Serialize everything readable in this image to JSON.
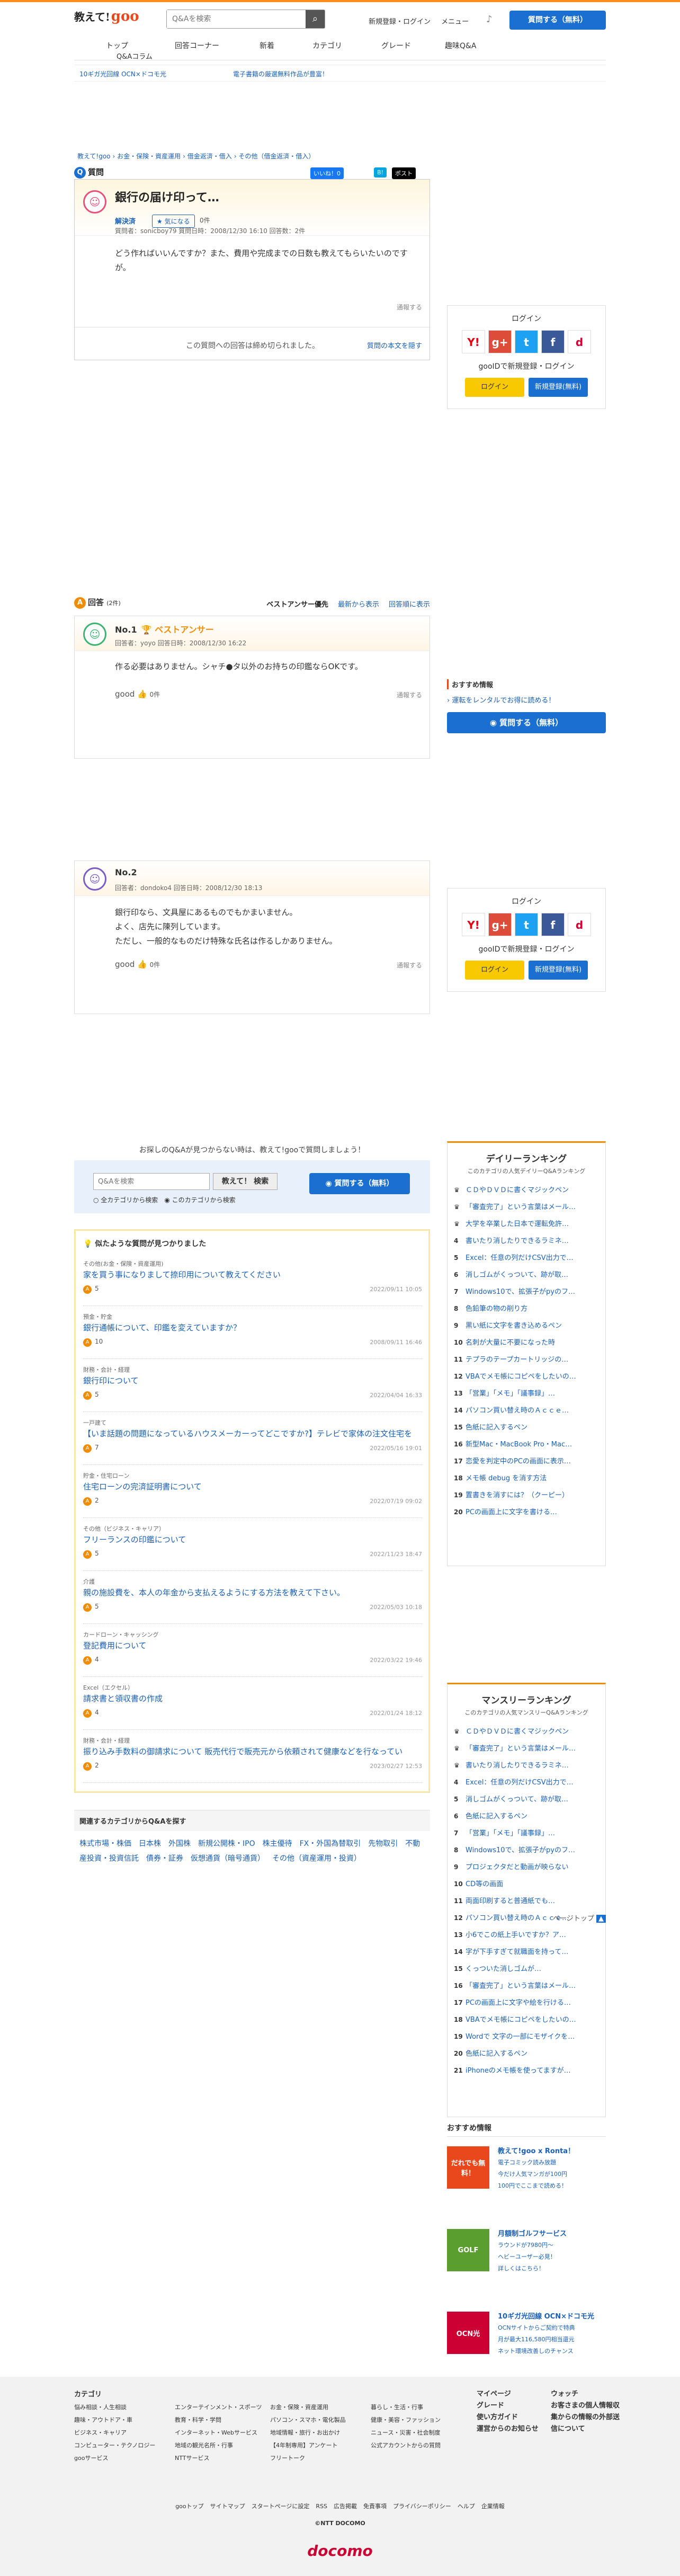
{
  "header": {
    "logo_small": "教えて!",
    "logo_main": "goo",
    "search_placeholder": "Q&Aを検索",
    "search_icon": "search-icon",
    "login_link": "新規登録・ログイン",
    "menu_link": "メニュー",
    "ask_button": "質問する（無料）"
  },
  "gnav": [
    "トップ",
    "回答コーナー",
    "新着",
    "カテゴリ",
    "グレード",
    "趣味Q&A"
  ],
  "gnav_sub": "Q&Aコラム",
  "ads": [
    "10ギガ光回線 OCN×ドコモ光",
    "電子書籍の厳選無料作品が豊富！"
  ],
  "breadcrumb": [
    "教えて!goo",
    "お金・保険・資産運用",
    "借金返済・借入",
    "その他（借金返済・借入）"
  ],
  "question": {
    "label": "質問",
    "share": [
      "いいね！0",
      "B!",
      "ポスト"
    ],
    "title": "銀行の届け印って…",
    "status": "解決済",
    "fav": "気になる",
    "fav_count": "0件",
    "meta": "質問者：sonicboy79  質問日時：2008/12/30 16:10  回答数：2件",
    "body": "どう作ればいいんですか？また、費用や完成までの日数も教えてもらいたいのですが。",
    "report": "通報する",
    "closed": "この質問への回答は締め切られました。",
    "show_body": "質問の本文を隠す"
  },
  "login_box": {
    "title": "ログイン",
    "sns": [
      "Y!",
      "g+",
      "t",
      "f",
      "d"
    ],
    "register_text": "gooIDで新規登録・ログイン",
    "login_btn": "ログイン",
    "register_btn": "新規登録(無料)"
  },
  "answers_header": {
    "label": "回答",
    "count": "(2件)",
    "sorts": [
      "ベストアンサー優先",
      "最新から表示",
      "回答順に表示"
    ]
  },
  "answers": [
    {
      "no": "No.1",
      "best": "ベストアンサー",
      "meta": "回答者：yoyo  回答日時：2008/12/30 16:22",
      "body": [
        "作る必要はありません。シャチ●タ以外のお持ちの印鑑ならOKです。"
      ],
      "good": "good",
      "good_count": "0件",
      "report": "通報する"
    },
    {
      "no": "No.2",
      "best": "",
      "meta": "回答者：dondoko4  回答日時：2008/12/30 18:13",
      "body": [
        "銀行印なら、文具屋にあるものでもかまいません。",
        "よく、店先に陳列しています。",
        "ただし、一般的なものだけ特殊な氏名は作るしかありません。"
      ],
      "good": "good",
      "good_count": "0件",
      "report": "通報する"
    }
  ],
  "recommend": {
    "title": "おすすめ情報",
    "link": "運転をレンタルでお得に読める！",
    "ask": "質問する（無料）"
  },
  "ask_again": {
    "text": "お探しのQ&Aが見つからない時は、教えて!gooで質問しましょう！",
    "placeholder": "Q&Aを検索",
    "search_btn": "教えて！ 検索",
    "radio1": "全カテゴリから検索",
    "radio2": "このカテゴリから検索",
    "ask_btn": "質問する（無料）"
  },
  "similar": {
    "title": "似たような質問が見つかりました",
    "items": [
      {
        "cat": "その他(お金・保険・資産運用)",
        "title": "家を買う事になりまして捺印用について教えてください",
        "count": "5",
        "date": "2022/09/11 10:05"
      },
      {
        "cat": "預金・貯金",
        "title": "銀行通帳について、印鑑を変えていますか？",
        "count": "10",
        "date": "2008/09/11 16:46"
      },
      {
        "cat": "財務・会計・経理",
        "title": "銀行印について",
        "count": "5",
        "date": "2022/04/04 16:33"
      },
      {
        "cat": "一戸建て",
        "title": "【いま話題の問題になっているハウスメーカーってどこですか?】テレビで家体の注文住宅を",
        "count": "7",
        "date": "2022/05/16 19:01"
      },
      {
        "cat": "貯金・住宅ローン",
        "title": "住宅ローンの完済証明書について",
        "count": "2",
        "date": "2022/07/19 09:02"
      },
      {
        "cat": "その他（ビジネス・キャリア）",
        "title": "フリーランスの印鑑について",
        "count": "5",
        "date": "2022/11/23 18:47"
      },
      {
        "cat": "介護",
        "title": "親の施設費を、本人の年金から支払えるようにする方法を教えて下さい。",
        "count": "5",
        "date": "2022/05/03 10:18"
      },
      {
        "cat": "カードローン・キャッシング",
        "title": "登記費用について",
        "count": "4",
        "date": "2022/03/22 19:46"
      },
      {
        "cat": "Excel（エクセル）",
        "title": "請求書と領収書の作成",
        "count": "4",
        "date": "2022/01/24 18:12"
      },
      {
        "cat": "財務・会計・経理",
        "title": "振り込み手数料の御請求について 販売代行で販売元から依頼されて健康などを行なってい",
        "count": "2",
        "date": "2023/02/27 12:53"
      }
    ]
  },
  "related": {
    "title": "関連するカテゴリからQ&Aを探す",
    "links": [
      "株式市場・株価",
      "日本株",
      "外国株",
      "新規公開株・IPO",
      "株主優待",
      "FX・外国為替取引",
      "先物取引",
      "不動産投資・投資信託",
      "債券・証券",
      "仮想通貨（暗号通貨）",
      "その他（資産運用・投資）"
    ]
  },
  "pagetop": "ページトップ",
  "daily_ranking": {
    "title": "デイリーランキング",
    "sub": "このカテゴリの人気デイリーQ&Aランキング",
    "items": [
      "ＣＤやＤＶＤに書くマジックペン",
      "「審査完了」という言葉はメール…",
      "大学を卒業した日本で運転免許…",
      "書いたり消したりできるラミネ…",
      "Excel：任意の列だけCSV出力で…",
      "消しゴムがくっついて、跡が取…",
      "Windows10で、拡張子がpyのフ…",
      "色鉛筆の物の削り方",
      "黒い紙に文字を書き込めるペン",
      "名刺が大量に不要になった時",
      "テプラのテープカートリッジの…",
      "VBAでメモ帳にコピペをしたいの…",
      "「営業」「メモ」「議事録」…",
      "パソコン買い替え時のＡｃｃｅ…",
      "色紙に記入するペン",
      "新型Mac・MacBook Pro・Mac…",
      "恋愛を判定中のPCの画面に表示…",
      "メモ帳 debug を消す方法",
      "置書きを消すには？（クーピー）",
      "PCの画面上に文字を書ける…"
    ]
  },
  "monthly_ranking": {
    "title": "マンスリーランキング",
    "sub": "このカテゴリの人気マンスリーQ&Aランキング",
    "items": [
      "ＣＤやＤＶＤに書くマジックペン",
      "「審査完了」という言葉はメール…",
      "書いたり消したりできるラミネ…",
      "Excel：任意の列だけCSV出力で…",
      "消しゴムがくっついて、跡が取…",
      "色紙に記入するペン",
      "「営業」「メモ」「議事録」…",
      "Windows10で、拡張子がpyのフ…",
      "プロジェクタだと動画が映らない",
      "CD等の画面",
      "両面印刷すると普通紙でも…",
      "パソコン買い替え時のＡｃｃｅ…",
      "小6でこの紙上手いですか？ア…",
      "字が下手すぎて就職面を持って…",
      "くっついた消しゴムが…",
      "「審査完了」という言葉はメール…",
      "PCの画面上に文字や絵を行ける…",
      "VBAでメモ帳にコピペをしたいの…",
      "Wordで 文字の一部にモザイクを…",
      "色紙に記入するペン",
      "iPhoneのメモ帳を使ってますが…"
    ]
  },
  "info": {
    "title": "おすすめ情報",
    "items": [
      {
        "thumb": "だれでも無料！",
        "color": "#e8481c",
        "head": "教えて!goo x Ronta！",
        "lines": [
          "電子コミック読み放題",
          "今だけ人気マンガが100円",
          "100円でここまで読める！"
        ]
      },
      {
        "thumb": "GOLF",
        "color": "#5a9e2f",
        "head": "月額制ゴルフサービス",
        "lines": [
          "ラウンドが7980円〜",
          "ヘビーユーザー必見！",
          "詳しくはこちら！"
        ]
      },
      {
        "thumb": "OCN光",
        "color": "#cc0033",
        "head": "10ギガ光回線 OCN×ドコモ光",
        "lines": [
          "OCNサイトからご契約で特典",
          "月が最大116,580円相当還元",
          "ネット環境改善しのチャンス"
        ]
      }
    ]
  },
  "footer": {
    "category": "カテゴリ",
    "col1": [
      "悩み相談・人生相談",
      "趣味・アウトドア・車",
      "ビジネス・キャリア",
      "コンピューター・テクノロジー",
      "gooサービス"
    ],
    "col2": [
      "エンターテインメント・スポーツ",
      "教育・科学・学問",
      "インターネット・Webサービス",
      "地域の観光名所・行事",
      "NTTサービス"
    ],
    "col3": [
      "お金・保険・資産運用",
      "パソコン・スマホ・電化製品",
      "地域情報・旅行・お出かけ",
      "【4年制専用】アンケート",
      "フリートーク"
    ],
    "col4": [
      "暮らし・生活・行事",
      "健康・美容・ファッション",
      "ニュース・災害・社会制度",
      "公式アカウントからの質問"
    ],
    "col5": [
      "マイページ",
      "グレード",
      "使い方ガイド",
      "運営からのお知らせ"
    ],
    "col6": [
      "ウォッチ",
      "お客さまの個人情報収集からの情報の外部送信について"
    ],
    "links": [
      "gooトップ",
      "サイトマップ",
      "スタートページに設定",
      "RSS",
      "広告掲載",
      "免責事項",
      "プライバシーポリシー",
      "ヘルプ",
      "企業情報"
    ],
    "copyright": "©NTT DOCOMO",
    "brand": "docomo"
  }
}
